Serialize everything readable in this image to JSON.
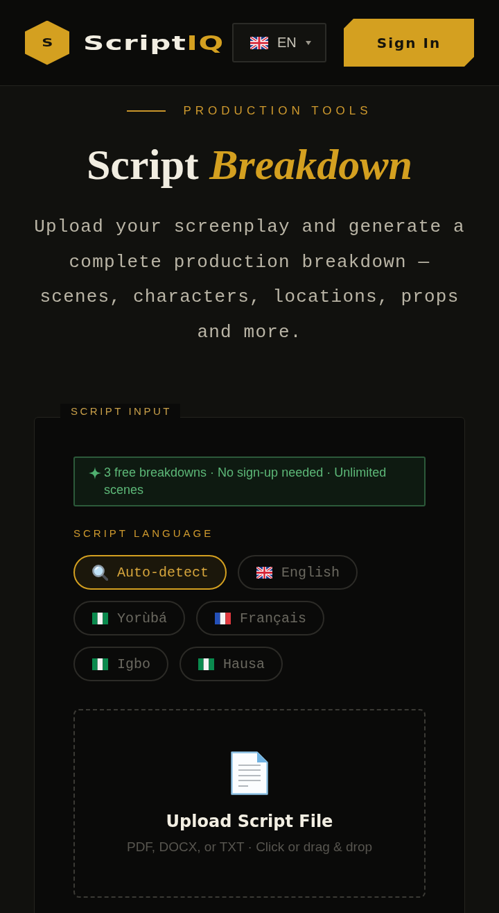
{
  "header": {
    "logo_letter": "S",
    "brand": {
      "name": "Script",
      "accent": "IQ"
    },
    "language_button": {
      "label": "EN"
    },
    "sign_in_button": {
      "label": "Sign In"
    }
  },
  "hero": {
    "eyebrow": "PRODUCTION TOOLS",
    "title": {
      "plain": "Script",
      "accent": "Breakdown"
    },
    "description": "Upload your screenplay and generate a complete production breakdown — scenes, characters, locations, props and more."
  },
  "script_input": {
    "tab_label": "SCRIPT INPUT",
    "notice": "3 free breakdowns · No sign-up needed · Unlimited scenes",
    "language_label": "SCRIPT LANGUAGE",
    "languages": [
      {
        "label": "Auto-detect",
        "selected": true
      },
      {
        "label": "English",
        "selected": false
      },
      {
        "label": "Yorùbá",
        "selected": false
      },
      {
        "label": "Français",
        "selected": false
      },
      {
        "label": "Igbo",
        "selected": false
      },
      {
        "label": "Hausa",
        "selected": false
      }
    ],
    "upload": {
      "title": "Upload Script File",
      "hint": "PDF, DOCX, or TXT · Click or drag & drop"
    }
  }
}
